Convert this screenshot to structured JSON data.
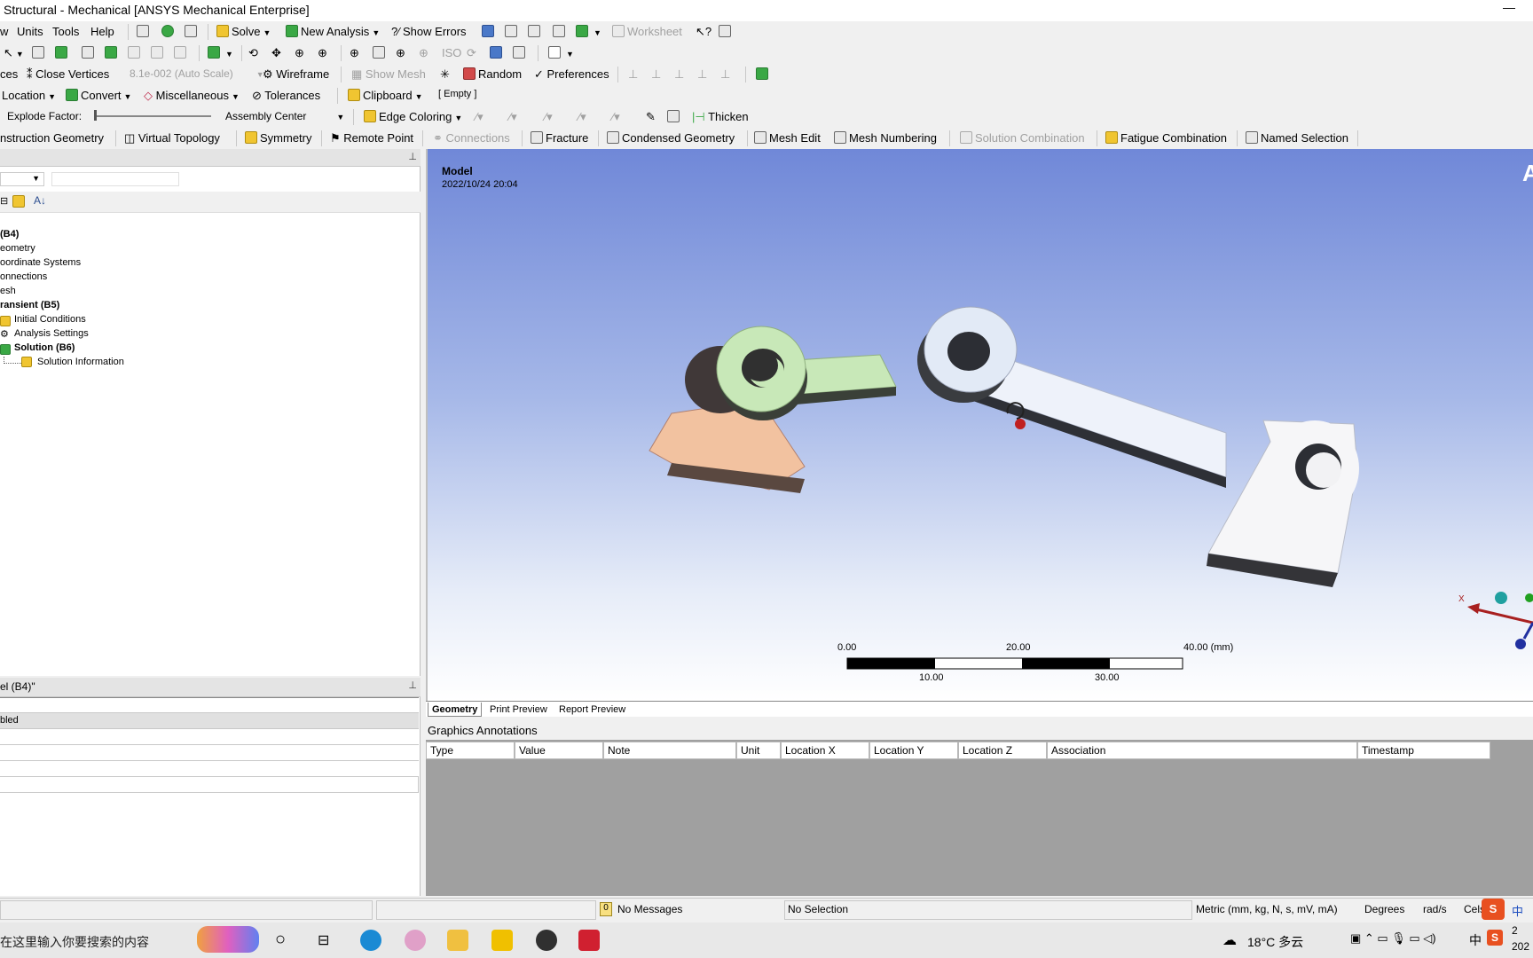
{
  "window": {
    "title": "Structural - Mechanical [ANSYS Mechanical Enterprise]"
  },
  "menu": {
    "items": [
      "w",
      "Units",
      "Tools",
      "Help"
    ],
    "solve": "Solve",
    "new_analysis": "New Analysis",
    "show_errors": "Show Errors",
    "worksheet": "Worksheet"
  },
  "toolbar3": {
    "close_vertices": "Close Vertices",
    "prefix": "ces",
    "scale_value": "8.1e-002 (Auto Scale)",
    "wireframe": "Wireframe",
    "show_mesh": "Show Mesh",
    "random": "Random",
    "preferences": "Preferences"
  },
  "toolbar4": {
    "location": "Location",
    "convert": "Convert",
    "miscellaneous": "Miscellaneous",
    "tolerances": "Tolerances",
    "clipboard": "Clipboard",
    "empty": "[ Empty ]"
  },
  "toolbar5": {
    "explode_label": "Explode Factor:",
    "assembly_center": "Assembly Center",
    "edge_coloring": "Edge Coloring",
    "thicken": "Thicken"
  },
  "context_toolbar": {
    "construction_geometry": "nstruction Geometry",
    "virtual_topology": "Virtual Topology",
    "symmetry": "Symmetry",
    "remote_point": "Remote Point",
    "connections": "Connections",
    "fracture": "Fracture",
    "condensed_geometry": "Condensed Geometry",
    "mesh_edit": "Mesh Edit",
    "mesh_numbering": "Mesh Numbering",
    "solution_combination": "Solution Combination",
    "fatigue_combination": "Fatigue Combination",
    "named_selection": "Named Selection"
  },
  "tree": {
    "items": [
      {
        "label": "(B4)",
        "bold": true
      },
      {
        "label": "eometry",
        "bold": false
      },
      {
        "label": "oordinate Systems",
        "bold": false
      },
      {
        "label": "onnections",
        "bold": false
      },
      {
        "label": "esh",
        "bold": false
      },
      {
        "label": "ransient (B5)",
        "bold": true
      },
      {
        "label": "Initial Conditions",
        "bold": false
      },
      {
        "label": "Analysis Settings",
        "bold": false
      },
      {
        "label": "Solution (B6)",
        "bold": true
      },
      {
        "label": "Solution Information",
        "bold": false
      }
    ]
  },
  "details": {
    "title": "el (B4)\"",
    "row1": "bled"
  },
  "viewport": {
    "model_label": "Model",
    "timestamp": "2022/10/24 20:04",
    "corner_letter": "A",
    "scale_ticks_top": [
      "0.00",
      "20.00",
      "40.00 (mm)"
    ],
    "scale_ticks_bottom": [
      "10.00",
      "30.00"
    ],
    "axis_x_label": "X"
  },
  "view_tabs": [
    "Geometry",
    "Print Preview",
    "Report Preview"
  ],
  "annotations": {
    "title": "Graphics Annotations",
    "columns": [
      "Type",
      "Value",
      "Note",
      "Unit",
      "Location X",
      "Location Y",
      "Location Z",
      "Association",
      "Timestamp"
    ]
  },
  "status": {
    "messages": "No Messages",
    "messages_count": "0",
    "selection": "No Selection",
    "units": "Metric (mm, kg, N, s, mV, mA)",
    "degrees": "Degrees",
    "rads": "rad/s",
    "temp": "Cels"
  },
  "taskbar": {
    "search_placeholder": "在这里输入你要搜索的内容",
    "weather": "18°C 多云",
    "ime": "中",
    "clock_top": "2",
    "clock_bottom": "202"
  },
  "colors": {
    "viewport_top": "#7088d8",
    "part_green": "#c8e8b8",
    "part_orange": "#f0c0a0",
    "part_white": "#f4f4f8"
  }
}
